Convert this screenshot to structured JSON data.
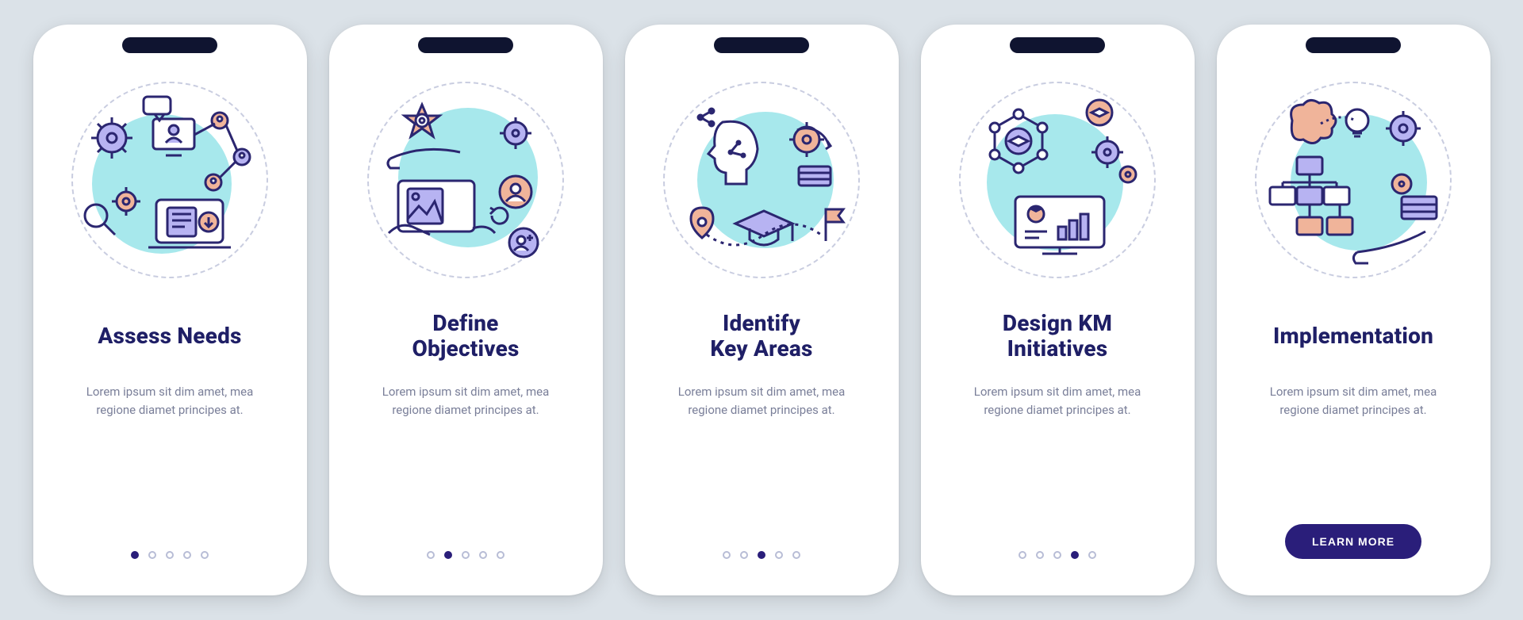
{
  "colors": {
    "background": "#dbe2e8",
    "card": "#ffffff",
    "heading": "#1f1f66",
    "body_text": "#7a7f99",
    "accent_purple": "#2a1e7a",
    "icon_purple": "#b7b3f2",
    "icon_peach": "#f0b49a",
    "icon_cyan": "#a7e8ec",
    "icon_line": "#2b2670",
    "dot_inactive": "#b8bdd6"
  },
  "screens": [
    {
      "id": "assess-needs",
      "title": "Assess Needs",
      "description": "Lorem ipsum sit dim amet, mea regione diamet principes at.",
      "active_index": 0,
      "total_dots": 5,
      "show_cta": false
    },
    {
      "id": "define-objectives",
      "title": "Define\nObjectives",
      "description": "Lorem ipsum sit dim amet, mea regione diamet principes at.",
      "active_index": 1,
      "total_dots": 5,
      "show_cta": false
    },
    {
      "id": "identify-key-areas",
      "title": "Identify\nKey Areas",
      "description": "Lorem ipsum sit dim amet, mea regione diamet principes at.",
      "active_index": 2,
      "total_dots": 5,
      "show_cta": false
    },
    {
      "id": "design-km-initiatives",
      "title": "Design KM\nInitiatives",
      "description": "Lorem ipsum sit dim amet, mea regione diamet principes at.",
      "active_index": 3,
      "total_dots": 5,
      "show_cta": false
    },
    {
      "id": "implementation",
      "title": "Implementation",
      "description": "Lorem ipsum sit dim amet, mea regione diamet principes at.",
      "active_index": 4,
      "total_dots": 5,
      "show_cta": true
    }
  ],
  "cta_label": "LEARN MORE"
}
